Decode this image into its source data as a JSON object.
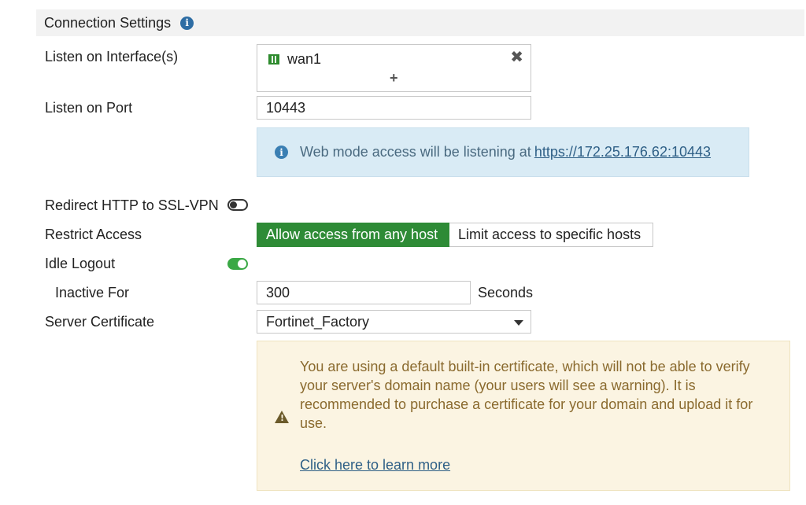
{
  "section": {
    "title": "Connection Settings"
  },
  "listen_interfaces": {
    "label": "Listen on Interface(s)",
    "items": [
      {
        "name": "wan1"
      }
    ],
    "add_symbol": "+",
    "remove_symbol": "✖"
  },
  "listen_port": {
    "label": "Listen on Port",
    "value": "10443"
  },
  "web_mode_info": {
    "text": "Web mode access will be listening at",
    "link": "https://172.25.176.62:10443"
  },
  "redirect_http": {
    "label": "Redirect HTTP to SSL-VPN",
    "enabled": false
  },
  "restrict_access": {
    "label": "Restrict Access",
    "options": [
      {
        "label": "Allow access from any host",
        "selected": true
      },
      {
        "label": "Limit access to specific hosts",
        "selected": false
      }
    ]
  },
  "idle_logout": {
    "label": "Idle Logout",
    "enabled": true
  },
  "inactive_for": {
    "label": "Inactive For",
    "value": "300",
    "unit": "Seconds"
  },
  "server_certificate": {
    "label": "Server Certificate",
    "selected": "Fortinet_Factory"
  },
  "certificate_warning": {
    "text": "You are using a default built-in certificate, which will not be able to verify your server's domain name (your users will see a warning). It is recommended to purchase a certificate for your domain and upload it for use.",
    "link": "Click here to learn more"
  },
  "colors": {
    "accent_green": "#2e8b36",
    "toggle_on": "#3aa845",
    "info_bg": "#d9ebf5",
    "warning_bg": "#fbf4e2",
    "link": "#2e5f86"
  }
}
